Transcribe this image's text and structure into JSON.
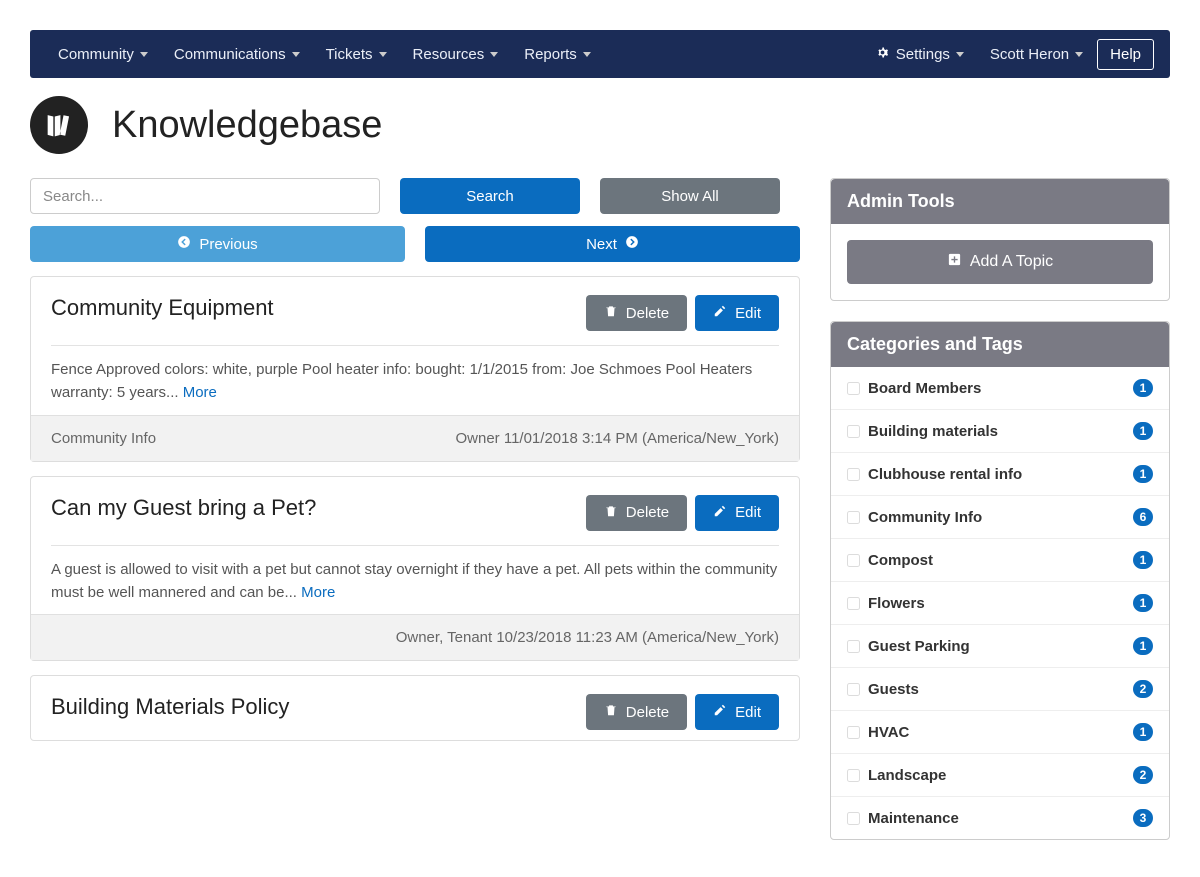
{
  "nav": {
    "left": [
      "Community",
      "Communications",
      "Tickets",
      "Resources",
      "Reports"
    ],
    "settings": "Settings",
    "user": "Scott Heron",
    "help": "Help"
  },
  "header": {
    "title": "Knowledgebase"
  },
  "search": {
    "placeholder": "Search...",
    "search_btn": "Search",
    "showall_btn": "Show All",
    "prev_btn": "Previous",
    "next_btn": "Next"
  },
  "actions": {
    "delete": "Delete",
    "edit": "Edit",
    "more": "More"
  },
  "topics": [
    {
      "title": "Community Equipment",
      "excerpt": "Fence Approved colors: white, purple Pool heater info: bought: 1/1/2015 from: Joe Schmoes Pool Heaters warranty: 5 years... ",
      "category": "Community Info",
      "timestamp": "Owner 11/01/2018 3:14 PM (America/New_York)"
    },
    {
      "title": "Can my Guest bring a Pet?",
      "excerpt": "A guest is allowed to visit with a pet but cannot stay overnight if they have a pet. All pets within the community must be well mannered and can be... ",
      "category": "",
      "timestamp": "Owner, Tenant 10/23/2018 11:23 AM (America/New_York)"
    },
    {
      "title": "Building Materials Policy",
      "excerpt": "",
      "category": "",
      "timestamp": ""
    }
  ],
  "admin": {
    "title": "Admin Tools",
    "add_topic": "Add A Topic"
  },
  "categories_panel": {
    "title": "Categories and Tags",
    "items": [
      {
        "name": "Board Members",
        "count": 1
      },
      {
        "name": "Building materials",
        "count": 1
      },
      {
        "name": "Clubhouse rental info",
        "count": 1
      },
      {
        "name": "Community Info",
        "count": 6
      },
      {
        "name": "Compost",
        "count": 1
      },
      {
        "name": "Flowers",
        "count": 1
      },
      {
        "name": "Guest Parking",
        "count": 1
      },
      {
        "name": "Guests",
        "count": 2
      },
      {
        "name": "HVAC",
        "count": 1
      },
      {
        "name": "Landscape",
        "count": 2
      },
      {
        "name": "Maintenance",
        "count": 3
      }
    ]
  }
}
